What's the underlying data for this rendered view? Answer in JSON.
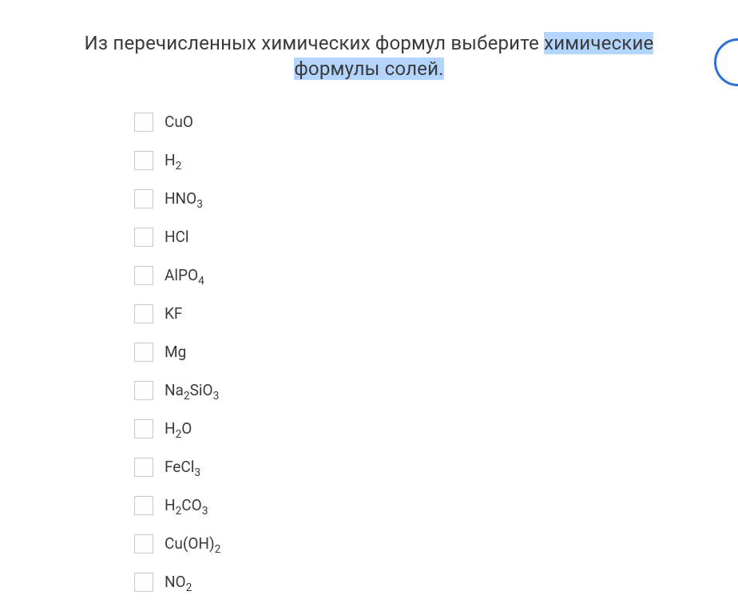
{
  "question": {
    "prefix": "Из перечисленных химических формул выберите ",
    "highlight1": "химические",
    "between": " ",
    "highlight2": "формулы солей."
  },
  "options": [
    {
      "parts": [
        {
          "t": "CuO"
        }
      ]
    },
    {
      "parts": [
        {
          "t": "H"
        },
        {
          "s": "2"
        }
      ]
    },
    {
      "parts": [
        {
          "t": "HNO"
        },
        {
          "s": "3"
        }
      ]
    },
    {
      "parts": [
        {
          "t": "HCl"
        }
      ]
    },
    {
      "parts": [
        {
          "t": "AlPO"
        },
        {
          "s": "4"
        }
      ]
    },
    {
      "parts": [
        {
          "t": "KF"
        }
      ]
    },
    {
      "parts": [
        {
          "t": "Mg"
        }
      ]
    },
    {
      "parts": [
        {
          "t": "Na"
        },
        {
          "s": "2"
        },
        {
          "t": "SiO"
        },
        {
          "s": "3"
        }
      ]
    },
    {
      "parts": [
        {
          "t": "H"
        },
        {
          "s": "2"
        },
        {
          "t": "O"
        }
      ]
    },
    {
      "parts": [
        {
          "t": "FeCl"
        },
        {
          "s": "3"
        }
      ]
    },
    {
      "parts": [
        {
          "t": "H"
        },
        {
          "s": "2"
        },
        {
          "t": "CO"
        },
        {
          "s": "3"
        }
      ]
    },
    {
      "parts": [
        {
          "t": "Cu(OH)"
        },
        {
          "s": "2"
        }
      ]
    },
    {
      "parts": [
        {
          "t": "NO"
        },
        {
          "s": "2"
        }
      ]
    }
  ]
}
